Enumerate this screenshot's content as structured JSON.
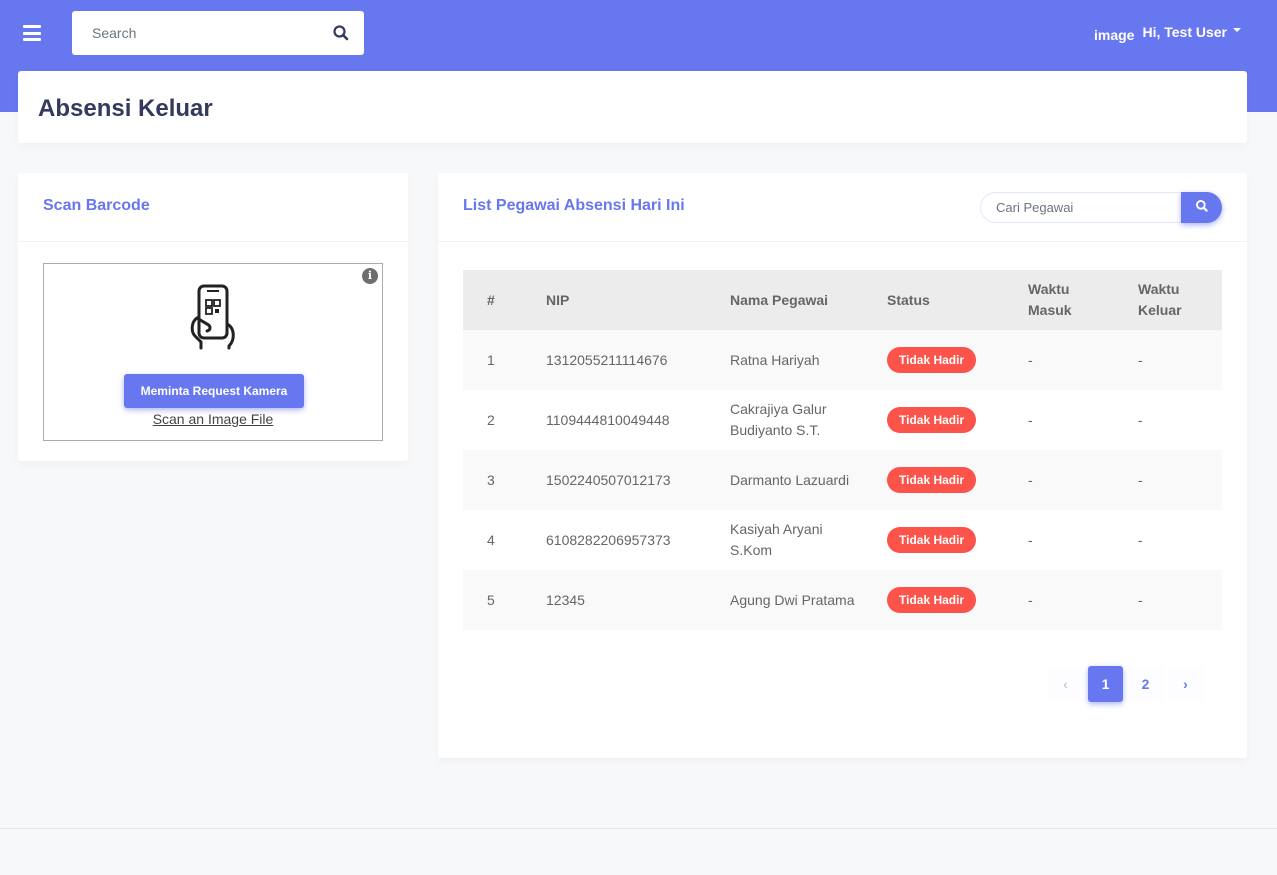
{
  "header": {
    "search_placeholder": "Search",
    "user_image_alt": "image",
    "user_greeting": "Hi, Test User"
  },
  "page": {
    "title": "Absensi Keluar"
  },
  "scan_card": {
    "title": "Scan Barcode",
    "request_camera_label": "Meminta Request Kamera",
    "scan_file_label": "Scan an Image File"
  },
  "list_card": {
    "title": "List Pegawai Absensi Hari Ini",
    "search_placeholder": "Cari Pegawai",
    "columns": [
      "#",
      "NIP",
      "Nama Pegawai",
      "Status",
      "Waktu Masuk",
      "Waktu Keluar"
    ],
    "rows": [
      {
        "no": "1",
        "nip": "1312055211114676",
        "name": "Ratna Hariyah",
        "status": "Tidak Hadir",
        "in": "-",
        "out": "-"
      },
      {
        "no": "2",
        "nip": "1109444810049448",
        "name": "Cakrajiya Galur Budiyanto S.T.",
        "status": "Tidak Hadir",
        "in": "-",
        "out": "-"
      },
      {
        "no": "3",
        "nip": "1502240507012173",
        "name": "Darmanto Lazuardi",
        "status": "Tidak Hadir",
        "in": "-",
        "out": "-"
      },
      {
        "no": "4",
        "nip": "6108282206957373",
        "name": "Kasiyah Aryani S.Kom",
        "status": "Tidak Hadir",
        "in": "-",
        "out": "-"
      },
      {
        "no": "5",
        "nip": "12345",
        "name": "Agung Dwi Pratama",
        "status": "Tidak Hadir",
        "in": "-",
        "out": "-"
      }
    ],
    "pagination": {
      "prev": "‹",
      "pages": [
        "1",
        "2"
      ],
      "next": "›",
      "current": "1"
    }
  },
  "colors": {
    "primary": "#6777ef",
    "danger": "#fc544b",
    "heading": "#34395e"
  }
}
